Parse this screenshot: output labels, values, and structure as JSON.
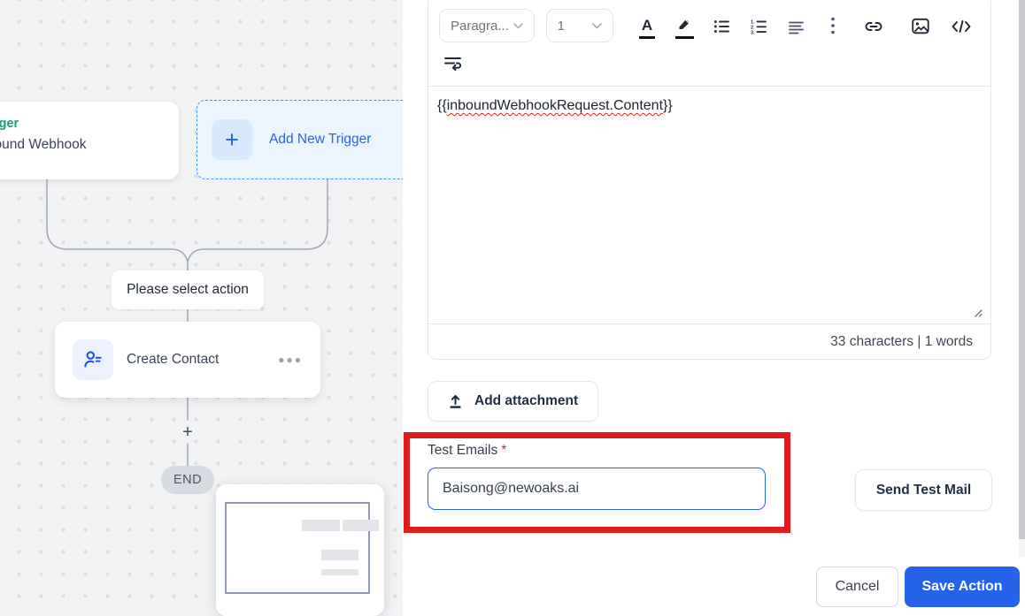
{
  "workflow_canvas": {
    "trigger_card": {
      "category_label": "Trigger",
      "title": "Inbound Webhook"
    },
    "add_new_trigger_button": {
      "label": "Add New Trigger",
      "plus_glyph": "+"
    },
    "action_placeholder_label": "Please select action",
    "create_contact_card": {
      "label": "Create Contact",
      "menu_glyph": "●●●"
    },
    "add_action_glyph": "+",
    "end_badge": "END"
  },
  "email_editor": {
    "toolbar": {
      "paragraph_dropdown_value": "Paragra...",
      "size_dropdown_value": "1",
      "text_color_glyph": "A",
      "icons": [
        "text-color",
        "highlighter",
        "bullet-list",
        "ordered-list",
        "align-left",
        "more-options",
        "insert-link",
        "insert-image",
        "code-view",
        "text-wrap"
      ]
    },
    "body": {
      "prefix": "{{",
      "merge_token": "inboundWebhookRequest.Content",
      "suffix": "}}"
    },
    "footer_counter": "33 characters | 1 words"
  },
  "attachment": {
    "add_attachment_label": "Add attachment"
  },
  "test_email_section": {
    "label": "Test Emails",
    "required_mark": "*",
    "input_value": "Baisong@newoaks.ai",
    "send_button_label": "Send Test Mail"
  },
  "footer_actions": {
    "cancel_label": "Cancel",
    "save_label": "Save Action"
  },
  "colors": {
    "accent_blue": "#2563eb",
    "light_blue_bg": "#ecf4fe",
    "annotation_red": "#de1c1c",
    "trigger_green": "#15a06e",
    "canvas_bg": "#f1f2f4"
  }
}
